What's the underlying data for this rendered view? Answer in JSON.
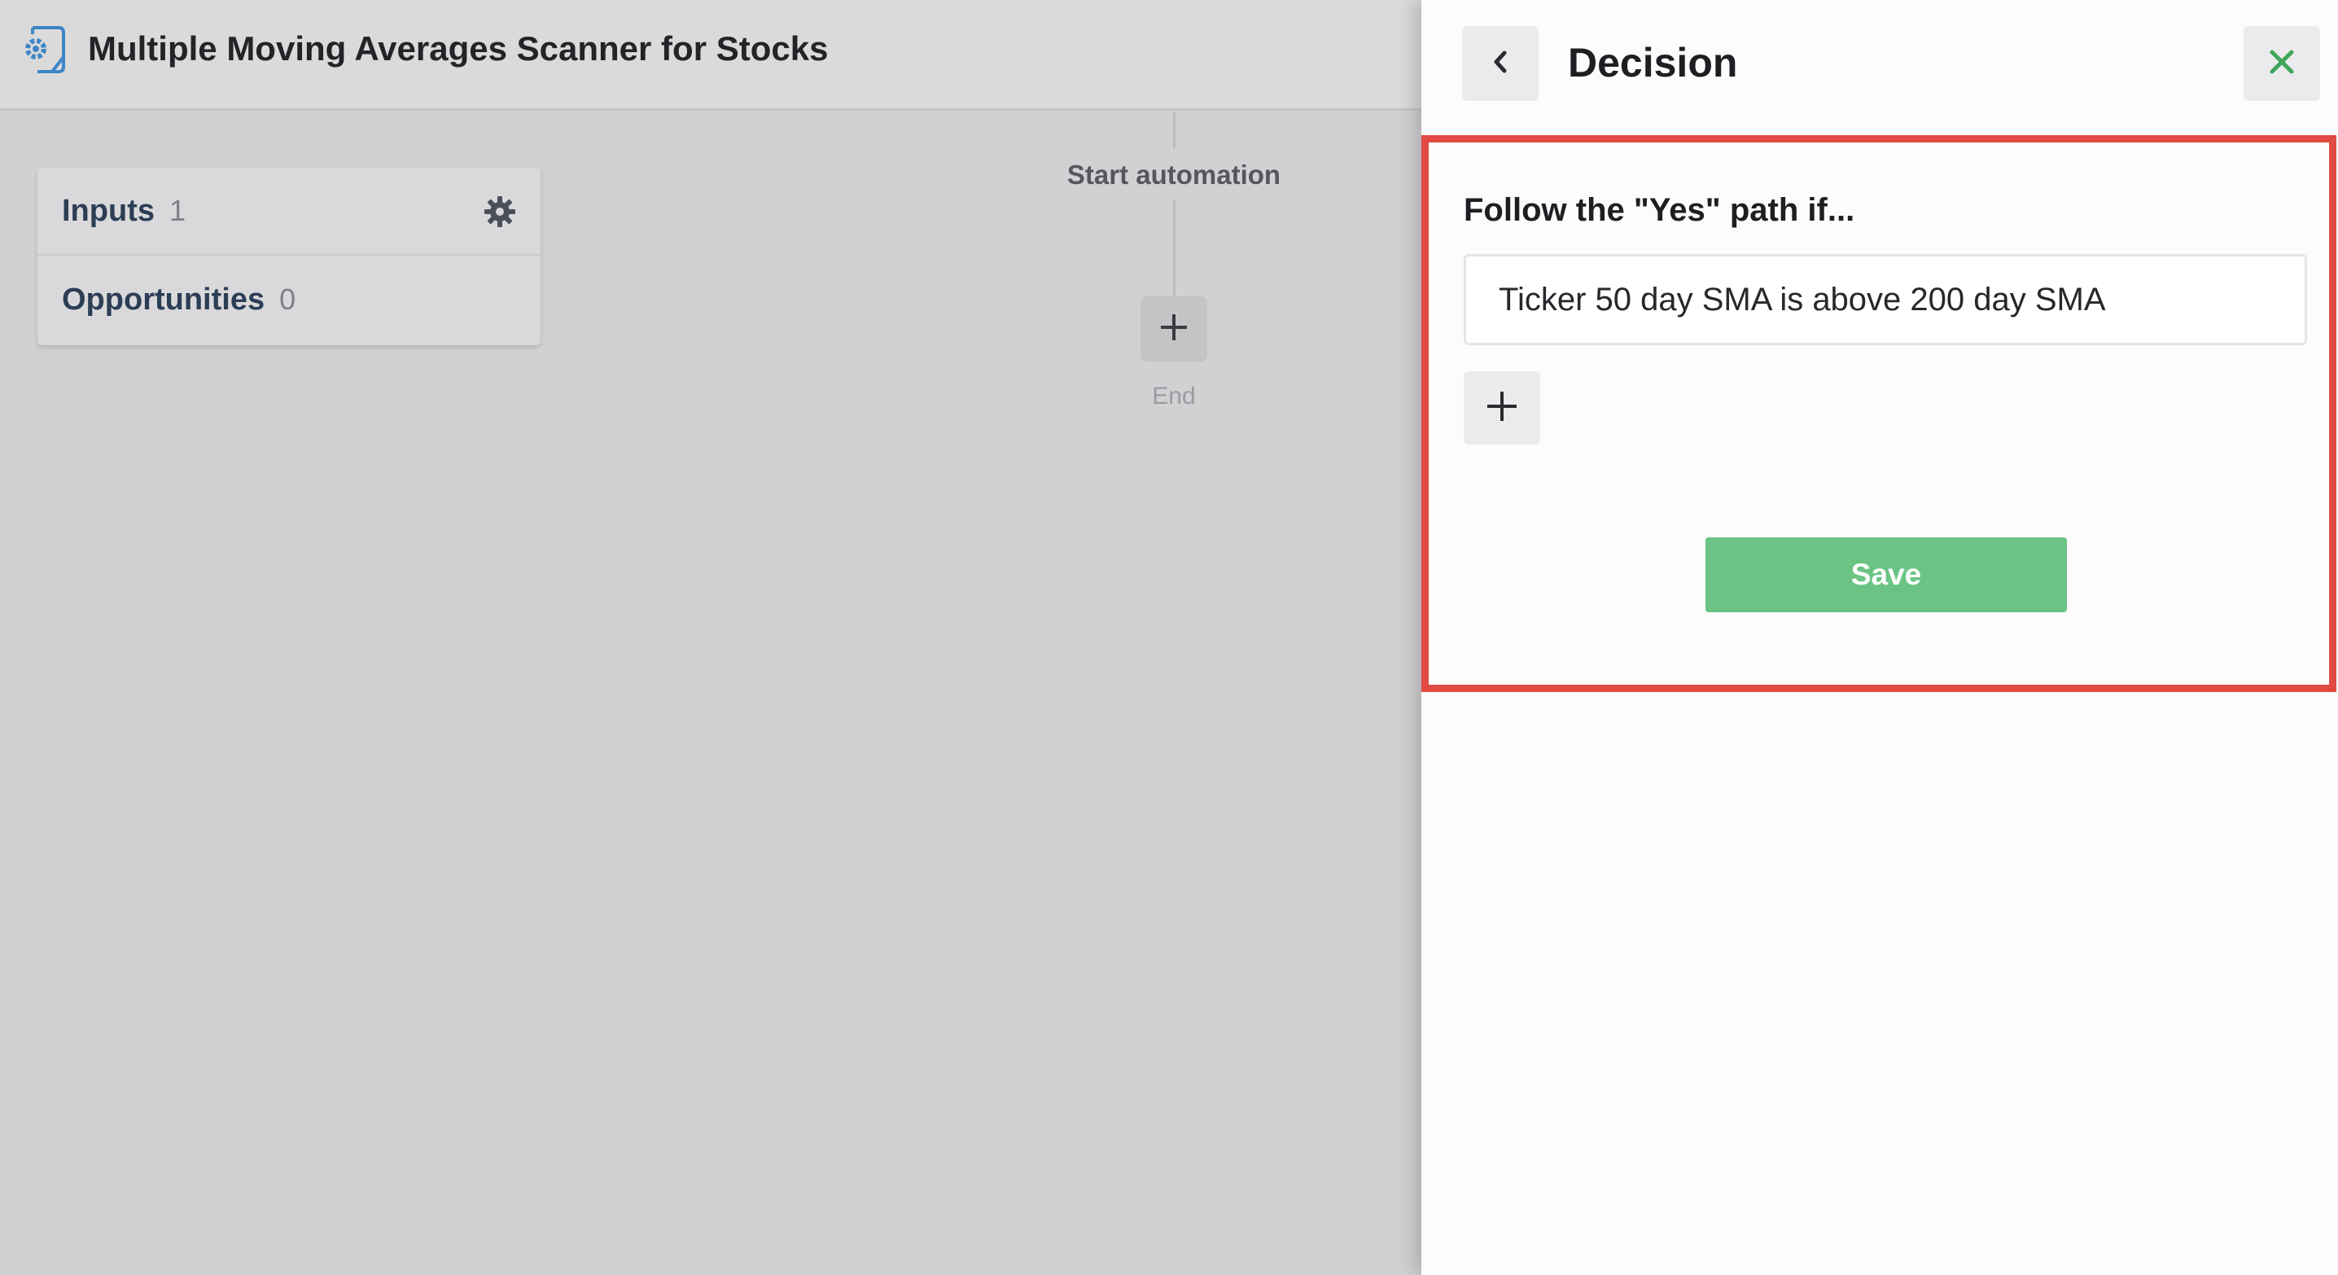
{
  "app": {
    "title": "Multiple Moving Averages Scanner for Stocks",
    "icon": "gear-document-icon"
  },
  "sidebar_card": {
    "items": [
      {
        "label": "Inputs",
        "count": "1",
        "icon": "gear-icon"
      },
      {
        "label": "Opportunities",
        "count": "0"
      }
    ]
  },
  "flow": {
    "start_label": "Start automation",
    "add_icon": "plus-icon",
    "end_label": "End"
  },
  "panel": {
    "title": "Decision",
    "back_icon": "chevron-left-icon",
    "close_icon": "close-icon",
    "condition_heading": "Follow the \"Yes\" path if...",
    "condition_value": "Ticker 50 day SMA is above 200 day SMA",
    "add_condition_icon": "plus-icon",
    "save_label": "Save"
  },
  "colors": {
    "accent_green": "#6bc484",
    "close_green": "#3fa65a",
    "highlight_red": "#e04a43",
    "app_icon_blue": "#3e86c6"
  }
}
